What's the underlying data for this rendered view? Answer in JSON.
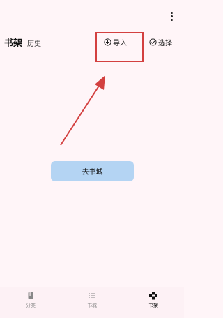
{
  "header": {
    "more_icon": "more-vert-icon",
    "tabs": [
      {
        "label": "书架",
        "active": true
      },
      {
        "label": "历史",
        "active": false
      }
    ],
    "import": {
      "label": "导入",
      "icon": "add-circle-icon"
    },
    "select": {
      "label": "选择",
      "icon": "check-circle-icon"
    }
  },
  "annotation": {
    "color": "#d34040"
  },
  "empty_state": {
    "button_label": "去书城",
    "button_color": "#b4d4f3"
  },
  "bottom_nav": {
    "items": [
      {
        "label": "分类",
        "icon": "book-icon",
        "active": false
      },
      {
        "label": "书城",
        "icon": "list-icon",
        "active": false
      },
      {
        "label": "书架",
        "icon": "bookshelf-icon",
        "active": true
      }
    ]
  }
}
